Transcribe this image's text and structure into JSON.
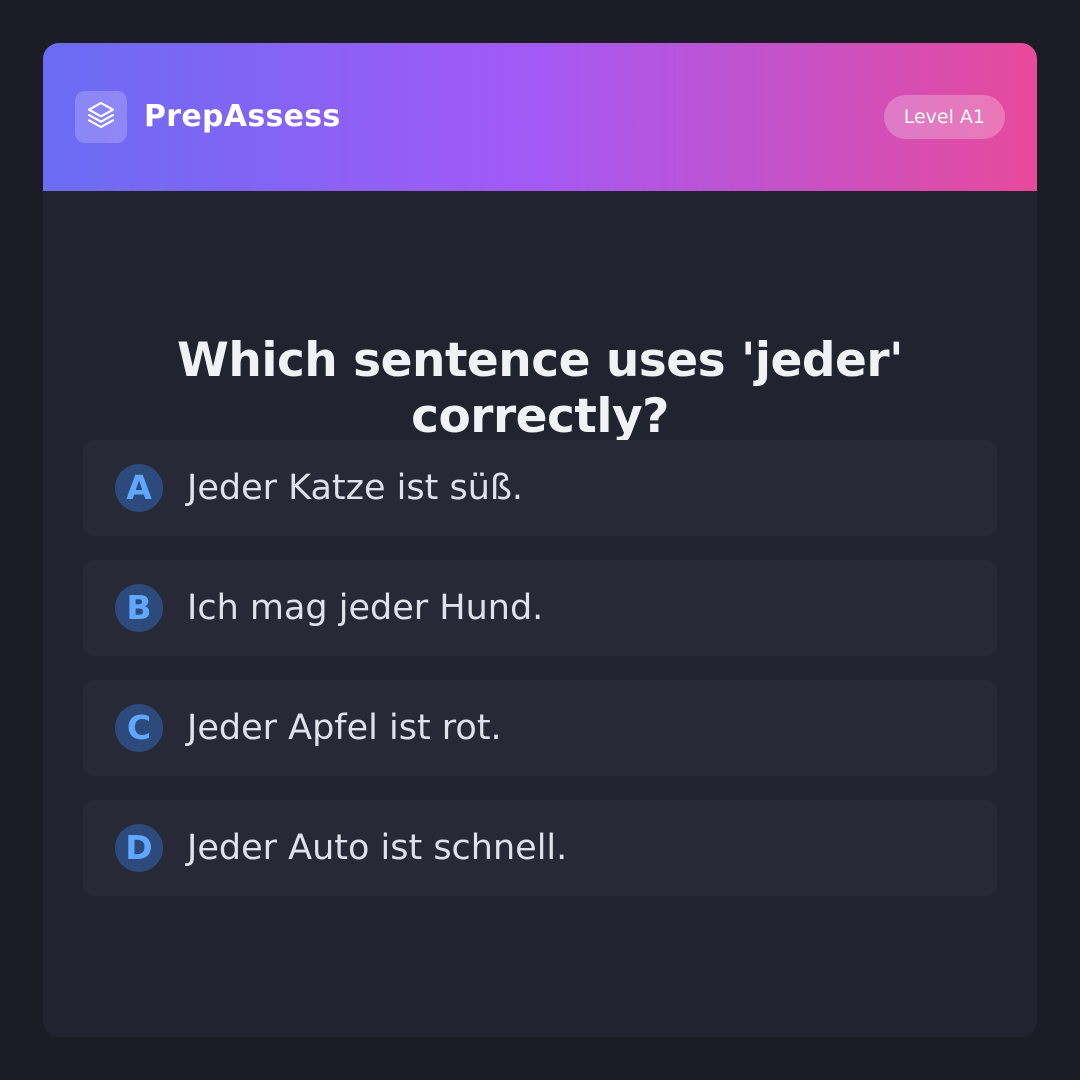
{
  "header": {
    "brand": "PrepAssess",
    "logo_icon": "layers-icon",
    "level_badge": "Level A1",
    "gradient_colors": [
      "#6a6cf3",
      "#a459f5",
      "#e84a9a"
    ]
  },
  "question": {
    "text": "Which sentence uses 'jeder' correctly?"
  },
  "options": [
    {
      "letter": "A",
      "text": "Jeder Katze ist süß."
    },
    {
      "letter": "B",
      "text": "Ich mag jeder Hund."
    },
    {
      "letter": "C",
      "text": "Jeder Apfel ist rot."
    },
    {
      "letter": "D",
      "text": "Jeder Auto ist schnell."
    }
  ],
  "colors": {
    "background": "#1b1c26",
    "card": "#21232f",
    "option_background": "#272936",
    "letter_badge": "#2d4a7c",
    "letter_text": "#5fa7ff"
  }
}
